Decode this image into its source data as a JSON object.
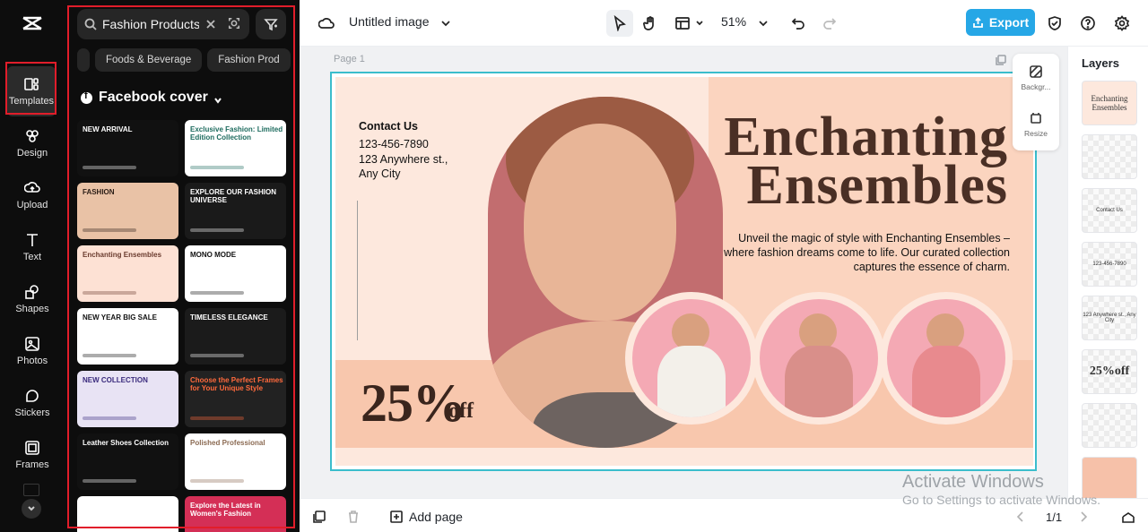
{
  "sidebar": {
    "items": [
      {
        "label": "Templates",
        "icon": "templates-icon"
      },
      {
        "label": "Design",
        "icon": "design-icon"
      },
      {
        "label": "Upload",
        "icon": "upload-icon"
      },
      {
        "label": "Text",
        "icon": "text-icon"
      },
      {
        "label": "Shapes",
        "icon": "shapes-icon"
      },
      {
        "label": "Photos",
        "icon": "photos-icon"
      },
      {
        "label": "Stickers",
        "icon": "stickers-icon"
      },
      {
        "label": "Frames",
        "icon": "frames-icon"
      }
    ]
  },
  "panel": {
    "search_value": "Fashion Products",
    "chips": [
      "Foods & Beverage",
      "Fashion Prod"
    ],
    "category": "Facebook cover",
    "thumbnails": [
      {
        "title": "NEW ARRIVAL",
        "bg": "#111111",
        "fg": "#ffffff"
      },
      {
        "title": "Exclusive Fashion: Limited Edition Collection",
        "bg": "#ffffff",
        "fg": "#1d6b5e"
      },
      {
        "title": "FASHION",
        "bg": "#e9c2a6",
        "fg": "#2b1d16"
      },
      {
        "title": "EXPLORE OUR FASHION UNIVERSE",
        "bg": "#1a1a1a",
        "fg": "#ffffff"
      },
      {
        "title": "Enchanting Ensembles",
        "bg": "#fde1d4",
        "fg": "#6a3b2e"
      },
      {
        "title": "MONO MODE",
        "bg": "#ffffff",
        "fg": "#111111"
      },
      {
        "title": "NEW YEAR BIG SALE",
        "bg": "#ffffff",
        "fg": "#111111"
      },
      {
        "title": "TIMELESS ELEGANCE",
        "bg": "#1b1b1b",
        "fg": "#ffffff"
      },
      {
        "title": "NEW COLLECTION",
        "bg": "#e8e3f4",
        "fg": "#3a2b7d"
      },
      {
        "title": "Choose the Perfect Frames for Your Unique Style",
        "bg": "#222222",
        "fg": "#ff6a3d"
      },
      {
        "title": "Leather Shoes Collection",
        "bg": "#111111",
        "fg": "#ffffff"
      },
      {
        "title": "Polished Professional",
        "bg": "#ffffff",
        "fg": "#8b6a52"
      },
      {
        "title": "",
        "bg": "#ffffff",
        "fg": "#ffffff"
      },
      {
        "title": "Explore the Latest in Women's Fashion",
        "bg": "#d42f56",
        "fg": "#ffffff"
      }
    ]
  },
  "topbar": {
    "title": "Untitled image",
    "zoom": "51%",
    "export_label": "Export"
  },
  "canvas": {
    "page_label": "Page 1",
    "float_tools": [
      "Backgr...",
      "Resize"
    ],
    "design": {
      "contact_heading": "Contact Us",
      "phone": "123-456-7890",
      "address1": "123 Anywhere st.,",
      "address2": "Any City",
      "heading1": "Enchanting",
      "heading2": "Ensembles",
      "subtitle": "Unveil the magic of style with Enchanting Ensembles – where fashion dreams come to life. Our curated collection captures the essence of charm.",
      "percent": "25%",
      "off": "off"
    }
  },
  "layers": {
    "title": "Layers",
    "items": [
      "Enchanting Ensembles",
      "",
      "Contact Us",
      "123-456-7890",
      "123 Anywhere st., Any City",
      "25%off",
      "",
      ""
    ]
  },
  "bottom": {
    "add_page": "Add page",
    "pager": "1/1"
  },
  "watermark": {
    "line1": "Activate Windows",
    "line2": "Go to Settings to activate Windows."
  },
  "colors": {
    "accent": "#26a7e6",
    "highlight": "#e11d2a",
    "selection": "#3bbdcc"
  }
}
